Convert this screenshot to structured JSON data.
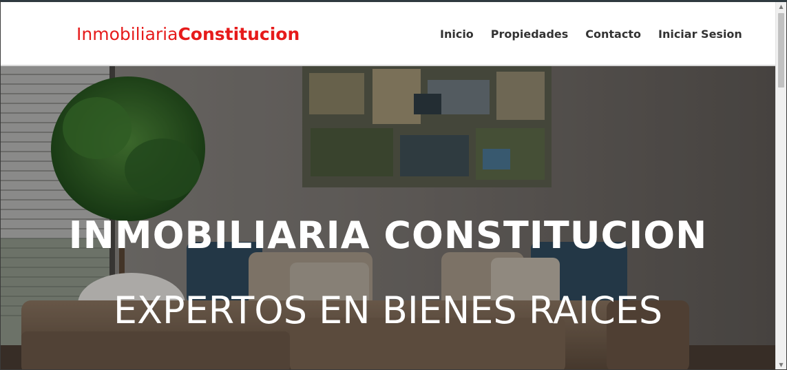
{
  "brand": {
    "light": "Inmobiliaria",
    "bold": "Constitucion"
  },
  "nav": {
    "items": [
      "Inicio",
      "Propiedades",
      "Contacto",
      "Iniciar Sesion"
    ]
  },
  "hero": {
    "title": "INMOBILIARIA CONSTITUCION",
    "subtitle": "EXPERTOS EN BIENES RAICES"
  },
  "colors": {
    "brand": "#e61b1b",
    "nav_text": "#333333",
    "hero_text": "#ffffff"
  },
  "icons": {
    "scroll_up": "▲",
    "scroll_down": "▼"
  }
}
